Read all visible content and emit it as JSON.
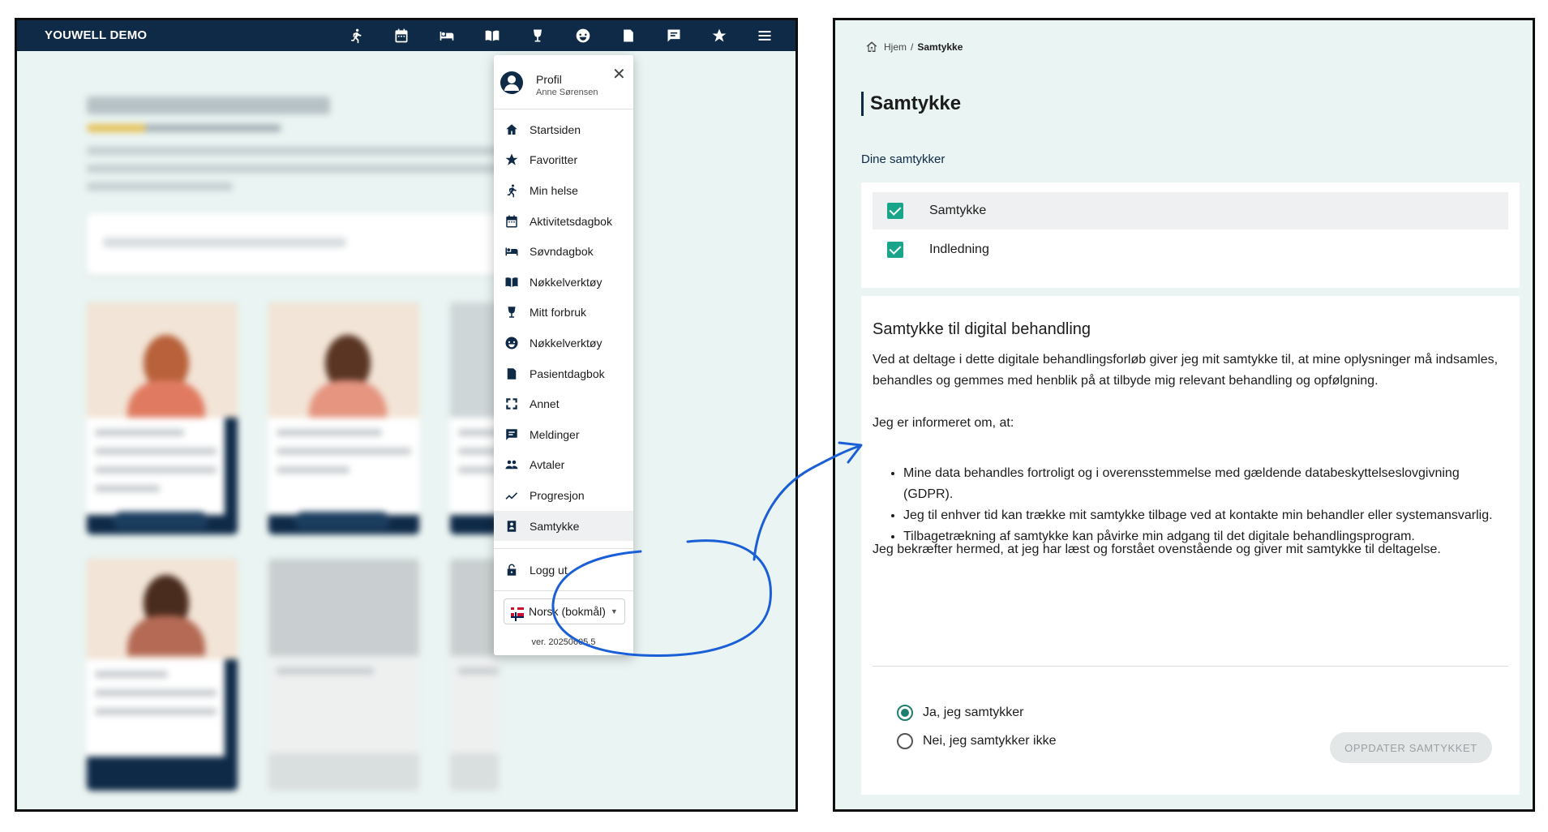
{
  "app": {
    "title": "YOUWELL DEMO"
  },
  "topbar_icons": [
    "running-icon",
    "calendar-icon",
    "bed-icon",
    "book-icon",
    "glass-icon",
    "emoji-icon",
    "diary-icon",
    "chat-icon",
    "star-icon",
    "menu-icon"
  ],
  "menu": {
    "profile_label": "Profil",
    "profile_name": "Anne Sørensen",
    "items": [
      {
        "label": "Startsiden",
        "icon": "home-icon"
      },
      {
        "label": "Favoritter",
        "icon": "star-icon"
      },
      {
        "label": "Min helse",
        "icon": "running-icon"
      },
      {
        "label": "Aktivitetsdagbok",
        "icon": "calendar-icon"
      },
      {
        "label": "Søvndagbok",
        "icon": "bed-icon"
      },
      {
        "label": "Nøkkelverktøy",
        "icon": "book-icon"
      },
      {
        "label": "Mitt forbruk",
        "icon": "glass-icon"
      },
      {
        "label": "Nøkkelverktøy",
        "icon": "emoji-icon"
      },
      {
        "label": "Pasientdagbok",
        "icon": "diary-icon"
      },
      {
        "label": "Annet",
        "icon": "crop-icon"
      },
      {
        "label": "Meldinger",
        "icon": "chat-icon"
      },
      {
        "label": "Avtaler",
        "icon": "people-icon"
      },
      {
        "label": "Progresjon",
        "icon": "trend-icon"
      },
      {
        "label": "Samtykke",
        "icon": "consent-icon"
      }
    ],
    "logout_label": "Logg ut",
    "language": "Norsk (bokmål)",
    "version": "ver. 20250605.5"
  },
  "consent_page": {
    "breadcrumb": {
      "home": "Hjem",
      "separator": "/",
      "current": "Samtykke"
    },
    "title": "Samtykke",
    "section_label": "Dine samtykker",
    "list": [
      {
        "label": "Samtykke",
        "checked": true,
        "selected": true
      },
      {
        "label": "Indledning",
        "checked": true,
        "selected": false
      }
    ],
    "detail": {
      "heading": "Samtykke til digital behandling",
      "intro": "Ved at deltage i dette digitale behandlingsforløb giver jeg mit samtykke til, at mine oplysninger må indsamles, behandles og gemmes med henblik på at tilbyde mig relevant behandling og opfølgning.",
      "informed": "Jeg er informeret om, at:",
      "bullets": [
        "Mine data behandles fortroligt og i overensstemmelse med gældende databeskyttelseslovgivning (GDPR).",
        "Jeg til enhver tid kan trække mit samtykke tilbage ved at kontakte min behandler eller systemansvarlig.",
        "Tilbagetrækning af samtykke kan påvirke min adgang til det digitale behandlingsprogram."
      ],
      "confirm": "Jeg bekræfter hermed, at jeg har læst og forstået ovenstående og giver mit samtykke til deltagelse.",
      "radio_yes": "Ja, jeg samtykker",
      "radio_no": "Nei, jeg samtykker ikke",
      "selected_option": "yes",
      "update_button": "OPPDATER SAMTYKKET"
    }
  },
  "colors": {
    "navy": "#0e2a47",
    "accent": "#1aa58a",
    "annotation": "#1a5fd6",
    "background": "#eaf4f2"
  }
}
